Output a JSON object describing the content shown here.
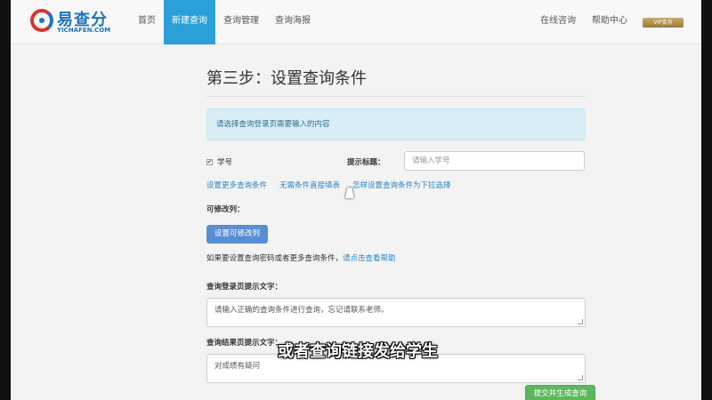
{
  "header": {
    "logo_cn": "易查分",
    "logo_en": "YICHAFEN.COM",
    "nav": [
      {
        "label": "首页",
        "active": false
      },
      {
        "label": "新建查询",
        "active": true
      },
      {
        "label": "查询管理",
        "active": false
      },
      {
        "label": "查询海报",
        "active": false
      }
    ],
    "right_nav": [
      {
        "label": "在线咨询"
      },
      {
        "label": "帮助中心"
      }
    ],
    "user_badge": "VIP会员"
  },
  "main": {
    "step_title": "第三步：设置查询条件",
    "info_text": "请选择查询登录页需要输入的内容",
    "field_checkbox_label": "学号",
    "field_checked": true,
    "hint_title_label": "提示标题：",
    "hint_input_placeholder": "请输入学号",
    "links": [
      {
        "label": "设置更多查询条件"
      },
      {
        "label": "无需条件直接填表"
      },
      {
        "label": "怎样设置查询条件为下拉选择"
      }
    ],
    "editable_label": "可修改列：",
    "editable_button": "设置可修改列",
    "help_prefix": "如果要设置查询密码或者更多查询条件，",
    "help_link": "请点击查看帮助",
    "login_tip_label": "查询登录页提示文字：",
    "login_tip_value": "请输入正确的查询条件进行查询，忘记请联系老师。",
    "result_tip_label": "查询结果页提示文字：",
    "result_tip_value": "对成绩有疑问",
    "submit_button": "提交并生成查询"
  },
  "overlay": {
    "subtitle": "或者查询链接发给学生"
  },
  "colors": {
    "nav_active": "#2a9fd8",
    "info_bg": "#d9edf7",
    "link": "#2a86c8",
    "primary_button": "#5a8ed4",
    "success_button": "#5cb85c"
  }
}
